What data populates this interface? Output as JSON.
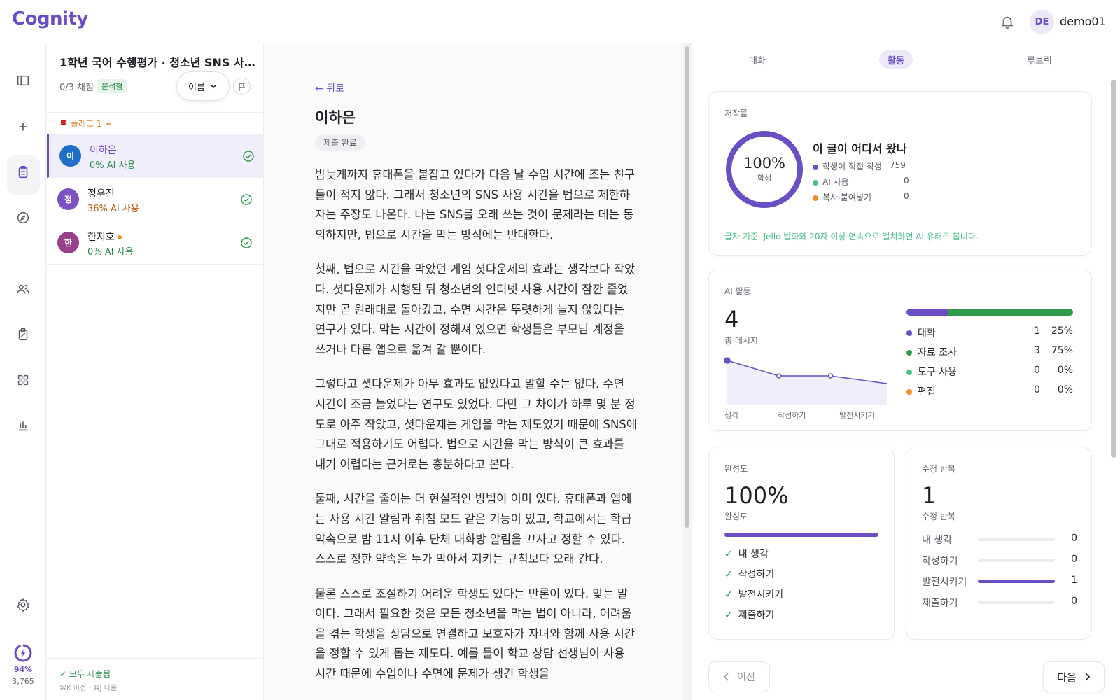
{
  "app": {
    "logo": "Cognity"
  },
  "user": {
    "initials": "DE",
    "name": "demo01"
  },
  "rail": {
    "gauge_pct": "94%",
    "gauge_num": "3,765"
  },
  "list": {
    "title": "1학년 국어 수행평가 · 청소년 SNS 사용 시...",
    "graded": "0/3 채점",
    "type_badge": "분석형",
    "sort_label": "이름",
    "flag_group": "플래그 1",
    "students": [
      {
        "initial": "이",
        "name": "이하은",
        "ai": "0% AI 사용",
        "color": "#1f6fc9",
        "ai_color": "#2a8a4a"
      },
      {
        "initial": "정",
        "name": "정우진",
        "ai": "36% AI 사용",
        "color": "#7a52c2",
        "ai_color": "#c05a10"
      },
      {
        "initial": "한",
        "name": "한지호",
        "ai": "0% AI 사용",
        "color": "#9a3f8a",
        "ai_color": "#2a8a4a"
      }
    ],
    "footer_status": "✓ 모두 제출됨",
    "footer_hint": "⌘K 이전 · ⌘J 다음"
  },
  "essay": {
    "back": "← 뒤로",
    "name": "이하은",
    "status": "제출 완료",
    "paragraphs": [
      "밤늦게까지 휴대폰을 붙잡고 있다가 다음 날 수업 시간에 조는 친구들이 적지 않다. 그래서 청소년의 SNS 사용 시간을 법으로 제한하자는 주장도 나온다. 나는 SNS를 오래 쓰는 것이 문제라는 데는 동의하지만, 법으로 시간을 막는 방식에는 반대한다.",
      "첫째, 법으로 시간을 막았던 게임 셧다운제의 효과는 생각보다 작았다. 셧다운제가 시행된 뒤 청소년의 인터넷 사용 시간이 잠깐 줄었지만 곧 원래대로 돌아갔고, 수면 시간은 뚜렷하게 늘지 않았다는 연구가 있다. 막는 시간이 정해져 있으면 학생들은 부모님 계정을 쓰거나 다른 앱으로 옮겨 갈 뿐이다.",
      "그렇다고 셧다운제가 아무 효과도 없었다고 말할 수는 없다. 수면 시간이 조금 늘었다는 연구도 있었다. 다만 그 차이가 하루 몇 분 정도로 아주 작았고, 셧다운제는 게임을 막는 제도였기 때문에 SNS에 그대로 적용하기도 어렵다. 법으로 시간을 막는 방식이 큰 효과를 내기 어렵다는 근거로는 충분하다고 본다.",
      "둘째, 시간을 줄이는 더 현실적인 방법이 이미 있다. 휴대폰과 앱에는 사용 시간 알림과 취침 모드 같은 기능이 있고, 학교에서는 학급 약속으로 밤 11시 이후 단체 대화방 알림을 끄자고 정할 수 있다. 스스로 정한 약속은 누가 막아서 지키는 규칙보다 오래 간다.",
      "물론 스스로 조절하기 어려운 학생도 있다는 반론이 있다. 맞는 말이다. 그래서 필요한 것은 모든 청소년을 막는 법이 아니라, 어려움을 겪는 학생을 상담으로 연결하고 보호자가 자녀와 함께 사용 시간을 정할 수 있게 돕는 제도다. 예를 들어 학교 상담 선생님이 사용 시간 때문에 수업이나 수면에 문제가 생긴 학생을"
    ]
  },
  "tabs": [
    "대화",
    "활동",
    "루브릭"
  ],
  "authorship": {
    "label": "저작률",
    "pct": "100%",
    "pct_label": "학생",
    "pct_value": 1.0,
    "title": "이 글이 어디서 왔나",
    "rows": [
      {
        "label": "학생이 직접 작성",
        "value": "759",
        "color": "#6a4fc4"
      },
      {
        "label": "AI 사용",
        "value": "0",
        "color": "#4bbf8a"
      },
      {
        "label": "복사·붙여넣기",
        "value": "0",
        "color": "#f08a24"
      }
    ],
    "note": "글자 기준. Jello 발화와 20자 이상 연속으로 일치하면 AI 유래로 봅니다."
  },
  "ai_activity": {
    "label": "AI 활동",
    "total": "4",
    "total_label": "총 메시지",
    "spark_values": [
      2,
      1,
      1,
      0.5
    ],
    "spark_labels": [
      "생각",
      "작성하기",
      "발전시키기"
    ],
    "rows": [
      {
        "label": "대화",
        "count": "1",
        "pct": "25%",
        "color": "#6a4fc4",
        "share": 0.25
      },
      {
        "label": "자료 조사",
        "count": "3",
        "pct": "75%",
        "color": "#2e9a4a",
        "share": 0.75
      },
      {
        "label": "도구 사용",
        "count": "0",
        "pct": "0%",
        "color": "#4bbf8a",
        "share": 0
      },
      {
        "label": "편집",
        "count": "0",
        "pct": "0%",
        "color": "#f08a24",
        "share": 0
      }
    ]
  },
  "completion": {
    "label": "완성도",
    "value": "100%",
    "sub": "완성도",
    "items": [
      "내 생각",
      "작성하기",
      "발전시키기",
      "제출하기"
    ]
  },
  "revisions": {
    "label": "수정 반복",
    "value": "1",
    "sub": "수정 반복",
    "rows": [
      {
        "label": "내 생각",
        "count": "0",
        "fill": 0
      },
      {
        "label": "작성하기",
        "count": "0",
        "fill": 0
      },
      {
        "label": "발전시키기",
        "count": "1",
        "fill": 1
      },
      {
        "label": "제출하기",
        "count": "0",
        "fill": 0
      }
    ]
  },
  "footer_nav": {
    "prev": "이전",
    "next": "다음"
  }
}
